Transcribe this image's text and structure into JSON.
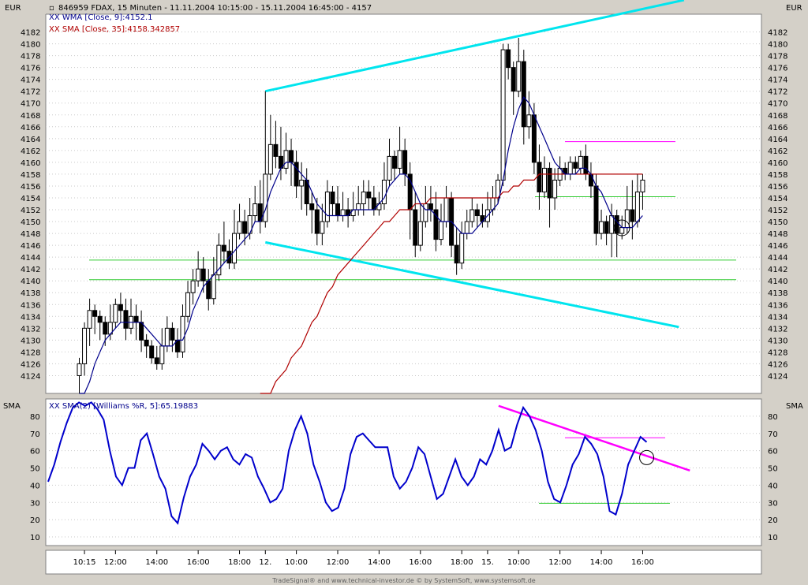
{
  "chart_data": [
    {
      "type": "candlestick",
      "currency_label": "EUR",
      "title": "846959  FDAX, 15 Minuten - 11.11.2004 10:15:00 - 15.11.2004 16:45:00 - 4157",
      "series": [
        {
          "name": "XX WMA [Close, 9]:4152.1",
          "color": "#00008b"
        },
        {
          "name": "XX SMA [Close, 35]:4158.342857",
          "color": "#b00000"
        }
      ],
      "y_ticks": [
        "4124",
        "4126",
        "4128",
        "4130",
        "4132",
        "4134",
        "4136",
        "4138",
        "4140",
        "4142",
        "4144",
        "4146",
        "4148",
        "4150",
        "4152",
        "4154",
        "4156",
        "4158",
        "4160",
        "4162",
        "4164",
        "4166",
        "4168",
        "4170",
        "4172",
        "4174",
        "4176",
        "4178",
        "4180",
        "4182"
      ],
      "ylim": [
        4121,
        4185
      ],
      "candles": [
        [
          4124,
          4126,
          4121,
          4127
        ],
        [
          4126,
          4132,
          4124,
          4133
        ],
        [
          4132,
          4135,
          4129,
          4137
        ],
        [
          4135,
          4134,
          4131,
          4136
        ],
        [
          4134,
          4133,
          4130,
          4135
        ],
        [
          4133,
          4131,
          4129,
          4134
        ],
        [
          4131,
          4133,
          4130,
          4136
        ],
        [
          4133,
          4136,
          4132,
          4137
        ],
        [
          4136,
          4135,
          4133,
          4138
        ],
        [
          4135,
          4132,
          4130,
          4137
        ],
        [
          4132,
          4134,
          4131,
          4137
        ],
        [
          4134,
          4133,
          4130,
          4136
        ],
        [
          4133,
          4130,
          4128,
          4135
        ],
        [
          4130,
          4129,
          4127,
          4131
        ],
        [
          4129,
          4127,
          4126,
          4130
        ],
        [
          4127,
          4126,
          4125,
          4129
        ],
        [
          4126,
          4129,
          4125,
          4132
        ],
        [
          4129,
          4132,
          4128,
          4134
        ],
        [
          4132,
          4130,
          4128,
          4133
        ],
        [
          4130,
          4128,
          4127,
          4132
        ],
        [
          4128,
          4134,
          4127,
          4136
        ],
        [
          4134,
          4138,
          4133,
          4140
        ],
        [
          4138,
          4140,
          4136,
          4142
        ],
        [
          4140,
          4142,
          4139,
          4145
        ],
        [
          4142,
          4140,
          4138,
          4144
        ],
        [
          4140,
          4137,
          4135,
          4142
        ],
        [
          4137,
          4141,
          4136,
          4144
        ],
        [
          4141,
          4146,
          4140,
          4148
        ],
        [
          4146,
          4145,
          4143,
          4150
        ],
        [
          4145,
          4143,
          4142,
          4147
        ],
        [
          4143,
          4148,
          4142,
          4152
        ],
        [
          4148,
          4150,
          4147,
          4153
        ],
        [
          4150,
          4148,
          4146,
          4152
        ],
        [
          4148,
          4151,
          4147,
          4154
        ],
        [
          4151,
          4153,
          4150,
          4156
        ],
        [
          4153,
          4150,
          4148,
          4157
        ],
        [
          4150,
          4158,
          4149,
          4172
        ],
        [
          4158,
          4163,
          4157,
          4168
        ],
        [
          4163,
          4161,
          4159,
          4167
        ],
        [
          4161,
          4159,
          4157,
          4166
        ],
        [
          4159,
          4162,
          4158,
          4165
        ],
        [
          4162,
          4160,
          4156,
          4164
        ],
        [
          4160,
          4156,
          4154,
          4162
        ],
        [
          4156,
          4157,
          4152,
          4160
        ],
        [
          4157,
          4153,
          4151,
          4159
        ],
        [
          4153,
          4152,
          4148,
          4155
        ],
        [
          4152,
          4148,
          4146,
          4154
        ],
        [
          4148,
          4150,
          4146,
          4153
        ],
        [
          4150,
          4155,
          4149,
          4157
        ],
        [
          4155,
          4153,
          4151,
          4156
        ],
        [
          4153,
          4151,
          4150,
          4156
        ],
        [
          4151,
          4152,
          4150,
          4155
        ],
        [
          4152,
          4151,
          4149,
          4154
        ],
        [
          4151,
          4152,
          4150,
          4155
        ],
        [
          4152,
          4153,
          4151,
          4156
        ],
        [
          4153,
          4155,
          4151,
          4157
        ],
        [
          4155,
          4154,
          4152,
          4157
        ],
        [
          4154,
          4152,
          4151,
          4156
        ],
        [
          4152,
          4153,
          4151,
          4155
        ],
        [
          4153,
          4157,
          4152,
          4160
        ],
        [
          4157,
          4161,
          4156,
          4164
        ],
        [
          4161,
          4159,
          4157,
          4162
        ],
        [
          4159,
          4162,
          4158,
          4166
        ],
        [
          4162,
          4158,
          4156,
          4164
        ],
        [
          4158,
          4152,
          4147,
          4160
        ],
        [
          4152,
          4146,
          4144,
          4155
        ],
        [
          4146,
          4150,
          4145,
          4153
        ],
        [
          4150,
          4153,
          4149,
          4156
        ],
        [
          4153,
          4152,
          4150,
          4156
        ],
        [
          4152,
          4147,
          4145,
          4155
        ],
        [
          4147,
          4150,
          4146,
          4153
        ],
        [
          4150,
          4154,
          4149,
          4156
        ],
        [
          4154,
          4146,
          4144,
          4155
        ],
        [
          4146,
          4143,
          4141,
          4149
        ],
        [
          4143,
          4148,
          4142,
          4150
        ],
        [
          4148,
          4150,
          4147,
          4152
        ],
        [
          4150,
          4152,
          4149,
          4154
        ],
        [
          4152,
          4151,
          4149,
          4153
        ],
        [
          4151,
          4150,
          4149,
          4153
        ],
        [
          4150,
          4152,
          4149,
          4155
        ],
        [
          4152,
          4154,
          4151,
          4156
        ],
        [
          4154,
          4157,
          4153,
          4158
        ],
        [
          4157,
          4179,
          4156,
          4180
        ],
        [
          4179,
          4176,
          4174,
          4180
        ],
        [
          4176,
          4172,
          4168,
          4177
        ],
        [
          4172,
          4177,
          4171,
          4181
        ],
        [
          4177,
          4166,
          4163,
          4179
        ],
        [
          4166,
          4168,
          4164,
          4172
        ],
        [
          4168,
          4160,
          4158,
          4170
        ],
        [
          4160,
          4155,
          4152,
          4163
        ],
        [
          4155,
          4159,
          4154,
          4161
        ],
        [
          4159,
          4154,
          4149,
          4160
        ],
        [
          4154,
          4157,
          4152,
          4159
        ],
        [
          4157,
          4159,
          4156,
          4161
        ],
        [
          4159,
          4158,
          4157,
          4160
        ],
        [
          4158,
          4160,
          4157,
          4161
        ],
        [
          4160,
          4159,
          4158,
          4161
        ],
        [
          4159,
          4161,
          4158,
          4162
        ],
        [
          4161,
          4158,
          4157,
          4163
        ],
        [
          4158,
          4156,
          4154,
          4160
        ],
        [
          4156,
          4148,
          4146,
          4158
        ],
        [
          4148,
          4150,
          4147,
          4152
        ],
        [
          4150,
          4148,
          4146,
          4151
        ],
        [
          4148,
          4151,
          4144,
          4153
        ],
        [
          4151,
          4148,
          4144,
          4152
        ],
        [
          4148,
          4149,
          4147,
          4151
        ],
        [
          4149,
          4152,
          4148,
          4156
        ],
        [
          4152,
          4150,
          4147,
          4157
        ],
        [
          4150,
          4155,
          4149,
          4158
        ],
        [
          4155,
          4157,
          4152,
          4158
        ]
      ],
      "wma_9": [
        4117,
        4120,
        4123,
        4126,
        4128,
        4130,
        4131,
        4132,
        4133,
        4133,
        4133,
        4133,
        4133,
        4132,
        4131,
        4130,
        4129,
        4129,
        4129,
        4130,
        4130,
        4132,
        4135,
        4137,
        4139,
        4140,
        4141,
        4142,
        4143,
        4144,
        4145,
        4146,
        4147,
        4148,
        4150,
        4150,
        4152,
        4155,
        4157,
        4159,
        4160,
        4160,
        4159,
        4158,
        4157,
        4155,
        4153,
        4152,
        4151,
        4151,
        4151,
        4151,
        4151,
        4152,
        4152,
        4152,
        4152,
        4152,
        4153,
        4154,
        4156,
        4157,
        4158,
        4158,
        4157,
        4155,
        4153,
        4152,
        4152,
        4151,
        4150,
        4150,
        4150,
        4149,
        4148,
        4148,
        4148,
        4149,
        4150,
        4151,
        4152,
        4153,
        4157,
        4162,
        4166,
        4169,
        4171,
        4170,
        4168,
        4166,
        4164,
        4162,
        4160,
        4159,
        4158,
        4158,
        4158,
        4159,
        4159,
        4158,
        4156,
        4155,
        4153,
        4151,
        4150,
        4149,
        4149,
        4149,
        4150,
        4151
      ],
      "sma_35": [
        null,
        null,
        null,
        null,
        null,
        null,
        null,
        null,
        null,
        null,
        null,
        null,
        null,
        null,
        null,
        null,
        null,
        null,
        null,
        null,
        null,
        null,
        null,
        null,
        null,
        null,
        null,
        null,
        null,
        null,
        null,
        null,
        null,
        null,
        null,
        4119,
        4120,
        4121,
        4123,
        4124,
        4125,
        4127,
        4128,
        4129,
        4131,
        4133,
        4134,
        4136,
        4138,
        4139,
        4141,
        4142,
        4143,
        4144,
        4145,
        4146,
        4147,
        4148,
        4149,
        4150,
        4150,
        4151,
        4152,
        4152,
        4152,
        4153,
        4153,
        4153,
        4154,
        4154,
        4154,
        4154,
        4154,
        4154,
        4154,
        4154,
        4154,
        4154,
        4154,
        4154,
        4154,
        4154,
        4155,
        4155,
        4156,
        4156,
        4157,
        4157,
        4157,
        4158,
        4158,
        4158,
        4158,
        4158,
        4158,
        4158,
        4158,
        4158,
        4158,
        4158,
        4158,
        4158,
        4158,
        4158,
        4158,
        4158,
        4158,
        4158,
        4158,
        4158
      ],
      "horizontal_levels": [
        4140.2,
        4143.5
      ],
      "resistance_level": 4163.5,
      "mid_level": 4154.2,
      "trendlines": [
        {
          "from": [
            36,
            4172
          ],
          "to": [
            117,
            4187.5
          ],
          "color": "#00e5ee"
        },
        {
          "from": [
            36,
            4146.5
          ],
          "to": [
            116,
            4132.2
          ],
          "color": "#00e5ee"
        }
      ]
    },
    {
      "type": "line",
      "currency_label": "SMA",
      "title": "XX SMA(2) [Williams %R, 5]:65.19883",
      "y_ticks": [
        "10",
        "20",
        "30",
        "40",
        "50",
        "60",
        "70",
        "80"
      ],
      "ylim": [
        5,
        90
      ],
      "values": [
        42,
        52,
        65,
        76,
        85,
        88,
        86,
        88,
        84,
        78,
        60,
        45,
        40,
        50,
        50,
        66,
        70,
        58,
        45,
        38,
        22,
        18,
        33,
        45,
        52,
        64,
        60,
        55,
        60,
        62,
        55,
        52,
        58,
        56,
        45,
        38,
        30,
        32,
        38,
        60,
        72,
        80,
        70,
        52,
        42,
        30,
        25,
        27,
        38,
        58,
        68,
        70,
        66,
        62,
        62,
        62,
        45,
        38,
        42,
        50,
        62,
        58,
        45,
        32,
        35,
        45,
        55,
        45,
        40,
        45,
        55,
        52,
        60,
        72,
        60,
        62,
        75,
        85,
        80,
        72,
        60,
        42,
        32,
        30,
        40,
        52,
        58,
        68,
        64,
        58,
        45,
        25,
        23,
        35,
        52,
        60,
        68,
        65
      ],
      "resistance_level": 67.5,
      "support_level": 29.5,
      "trendline": {
        "from": [
          73,
          86
        ],
        "to": [
          104,
          48.5
        ],
        "color": "#ff00ff"
      },
      "circle": {
        "index": 97,
        "value": 56
      }
    }
  ],
  "x_axis": {
    "labels": [
      "10:15",
      "12:00",
      "14:00",
      "16:00",
      "18:00",
      "12.",
      "10:00",
      "12:00",
      "14:00",
      "16:00",
      "18:00",
      "15.",
      "10:00",
      "12:00",
      "14:00",
      "16:00"
    ],
    "positions": [
      1,
      7,
      15,
      23,
      31,
      36,
      42,
      50,
      58,
      66,
      74,
      79,
      85,
      93,
      101,
      109
    ]
  },
  "footer": "TradeSignal® and www.technical-investor.de © by SystemSoft, www.systemsoft.de"
}
